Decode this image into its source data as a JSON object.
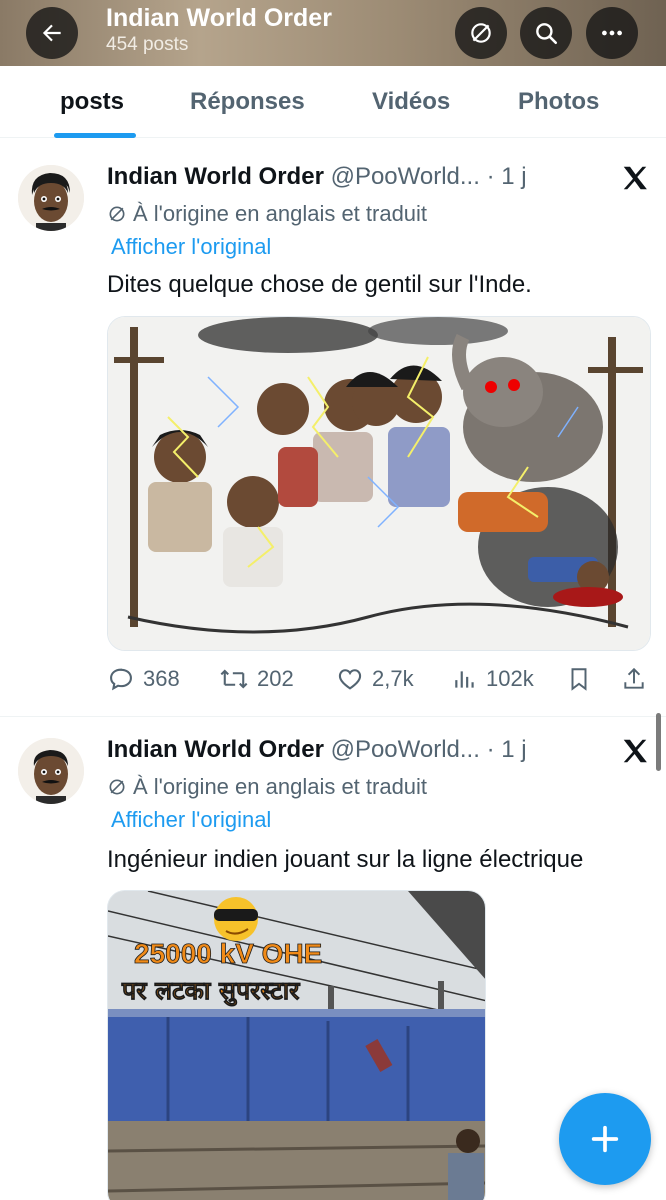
{
  "header": {
    "title": "Indian World Order",
    "post_count": "454 posts",
    "icons": [
      "back-arrow-icon",
      "translate-globe-icon",
      "search-icon",
      "more-dots-icon"
    ]
  },
  "tabs": [
    {
      "label": "posts",
      "active": true
    },
    {
      "label": "Réponses",
      "active": false
    },
    {
      "label": "Vidéos",
      "active": false
    },
    {
      "label": "Photos",
      "active": false
    }
  ],
  "posts": [
    {
      "display_name": "Indian World Order",
      "handle": "@PooWorld...",
      "time": "· 1 j",
      "translated_note": "À l'origine en anglais et traduit",
      "show_original": "Afficher l'original",
      "text": "Dites quelque chose de gentil sur l'Inde.",
      "stats": {
        "replies": "368",
        "reposts": "202",
        "likes": "2,7k",
        "views": "102k"
      }
    },
    {
      "display_name": "Indian World Order",
      "handle": "@PooWorld...",
      "time": "· 1 j",
      "translated_note": "À l'origine en anglais et traduit",
      "show_original": "Afficher l'original",
      "text": "Ingénieur indien jouant sur la ligne électrique",
      "video_caption_line1": "25000 kV OHE",
      "video_caption_line2": "पर लटका सुपरस्टार"
    }
  ],
  "colors": {
    "accent": "#1d9bf0",
    "text_secondary": "#536471",
    "text_primary": "#0f1419"
  }
}
